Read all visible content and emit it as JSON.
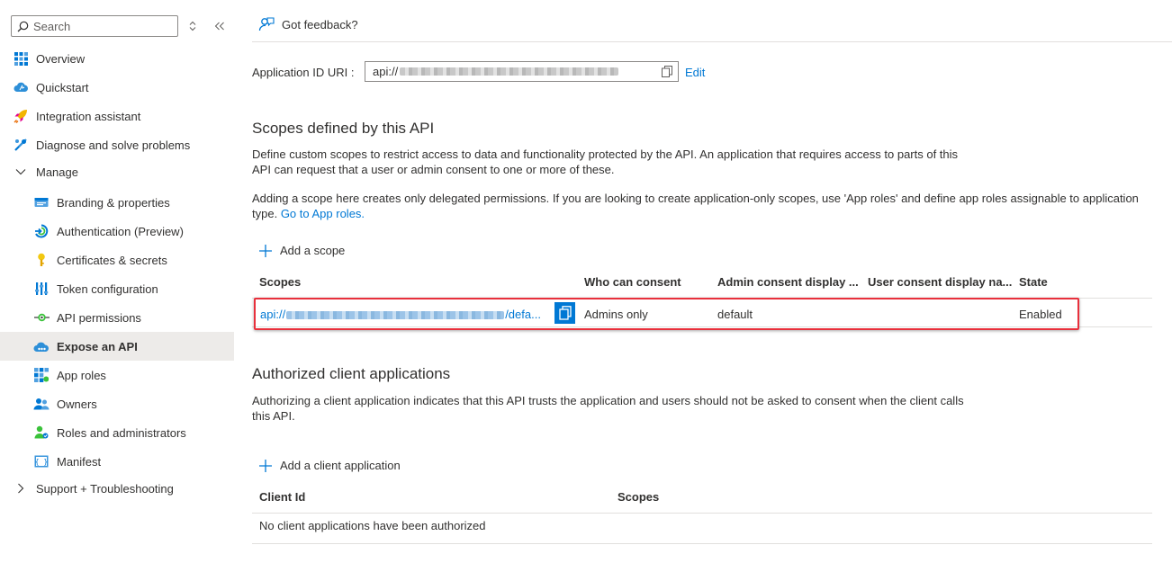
{
  "sidebar": {
    "search_placeholder": "Search",
    "items": [
      {
        "label": "Overview",
        "icon": "overview-grid-icon"
      },
      {
        "label": "Quickstart",
        "icon": "cloud-quickstart-icon"
      },
      {
        "label": "Integration assistant",
        "icon": "rocket-icon"
      },
      {
        "label": "Diagnose and solve problems",
        "icon": "wrench-icon"
      },
      {
        "label": "Manage",
        "icon": "chevron-down-icon"
      },
      {
        "label": "Branding & properties",
        "icon": "branding-card-icon"
      },
      {
        "label": "Authentication (Preview)",
        "icon": "authentication-icon"
      },
      {
        "label": "Certificates & secrets",
        "icon": "key-icon"
      },
      {
        "label": "Token configuration",
        "icon": "token-bars-icon"
      },
      {
        "label": "API permissions",
        "icon": "api-permissions-icon"
      },
      {
        "label": "Expose an API",
        "icon": "cloud-api-icon"
      },
      {
        "label": "App roles",
        "icon": "app-roles-grid-icon"
      },
      {
        "label": "Owners",
        "icon": "owners-people-icon"
      },
      {
        "label": "Roles and administrators",
        "icon": "roles-admin-icon"
      },
      {
        "label": "Manifest",
        "icon": "manifest-icon"
      },
      {
        "label": "Support + Troubleshooting",
        "icon": "chevron-right-icon"
      }
    ],
    "active": "Expose an API"
  },
  "header": {
    "feedback_label": "Got feedback?"
  },
  "app_id": {
    "label": "Application ID URI :",
    "value_prefix": "api://",
    "edit_label": "Edit"
  },
  "scopes_section": {
    "title": "Scopes defined by this API",
    "desc1": "Define custom scopes to restrict access to data and functionality protected by the API. An application that requires access to parts of this API can request that a user or admin consent to one or more of these.",
    "desc2": "Adding a scope here creates only delegated permissions. If you are looking to create application-only scopes, use 'App roles' and define app roles assignable to application type.",
    "desc2_link": "Go to App roles.",
    "add_label": "Add a scope",
    "columns": [
      "Scopes",
      "Who can consent",
      "Admin consent display ...",
      "User consent display na...",
      "State"
    ],
    "rows": [
      {
        "scope_prefix": "api://",
        "scope_suffix": "/defa...",
        "who_can_consent": "Admins only",
        "admin_consent_display": "default",
        "user_consent_display": "",
        "state": "Enabled"
      }
    ]
  },
  "clients_section": {
    "title": "Authorized client applications",
    "desc": "Authorizing a client application indicates that this API trusts the application and users should not be asked to consent when the client calls this API.",
    "add_label": "Add a client application",
    "columns": [
      "Client Id",
      "Scopes"
    ],
    "empty_text": "No client applications have been authorized"
  },
  "colors": {
    "accent": "#0078d4",
    "highlight_border": "#e8303c",
    "active_bg": "#edebe9"
  }
}
